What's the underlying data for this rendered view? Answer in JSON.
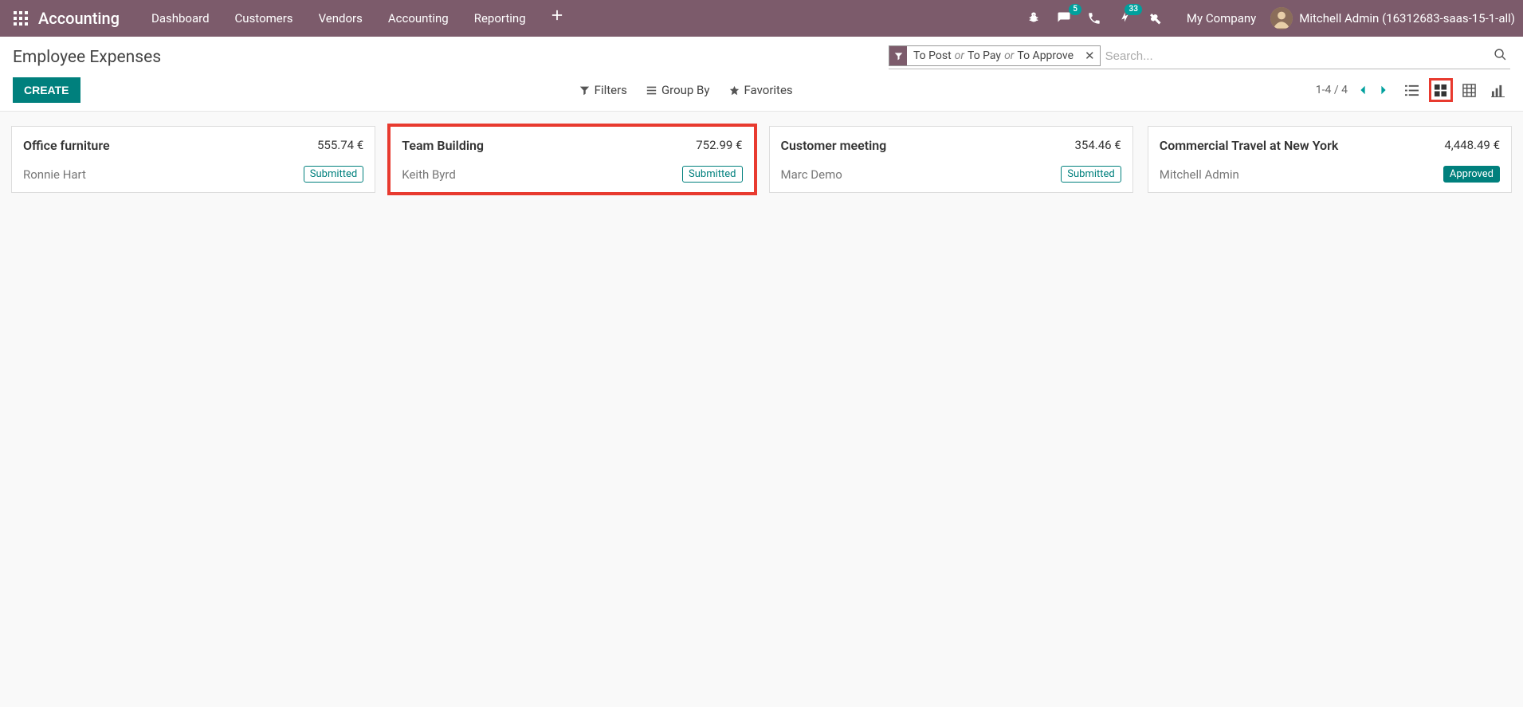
{
  "navbar": {
    "app_title": "Accounting",
    "menu": [
      "Dashboard",
      "Customers",
      "Vendors",
      "Accounting",
      "Reporting"
    ],
    "badge_chat": "5",
    "badge_activity": "33",
    "company": "My Company",
    "user_name": "Mitchell Admin (16312683-saas-15-1-all)"
  },
  "control_panel": {
    "title": "Employee Expenses",
    "create_label": "CREATE",
    "filter_chip": {
      "p1": "To Post",
      "or1": "or",
      "p2": "To Pay",
      "or2": "or",
      "p3": "To Approve"
    },
    "search_placeholder": "Search...",
    "filters_label": "Filters",
    "groupby_label": "Group By",
    "favorites_label": "Favorites",
    "pager": "1-4 / 4"
  },
  "expenses": [
    {
      "title": "Office furniture",
      "amount": "555.74 €",
      "employee": "Ronnie Hart",
      "status_label": "Submitted",
      "status_class": "status-submitted",
      "highlight": false
    },
    {
      "title": "Team Building",
      "amount": "752.99 €",
      "employee": "Keith Byrd",
      "status_label": "Submitted",
      "status_class": "status-submitted",
      "highlight": true
    },
    {
      "title": "Customer meeting",
      "amount": "354.46 €",
      "employee": "Marc Demo",
      "status_label": "Submitted",
      "status_class": "status-submitted",
      "highlight": false
    },
    {
      "title": "Commercial Travel at New York",
      "amount": "4,448.49 €",
      "employee": "Mitchell Admin",
      "status_label": "Approved",
      "status_class": "status-approved",
      "highlight": false
    }
  ]
}
